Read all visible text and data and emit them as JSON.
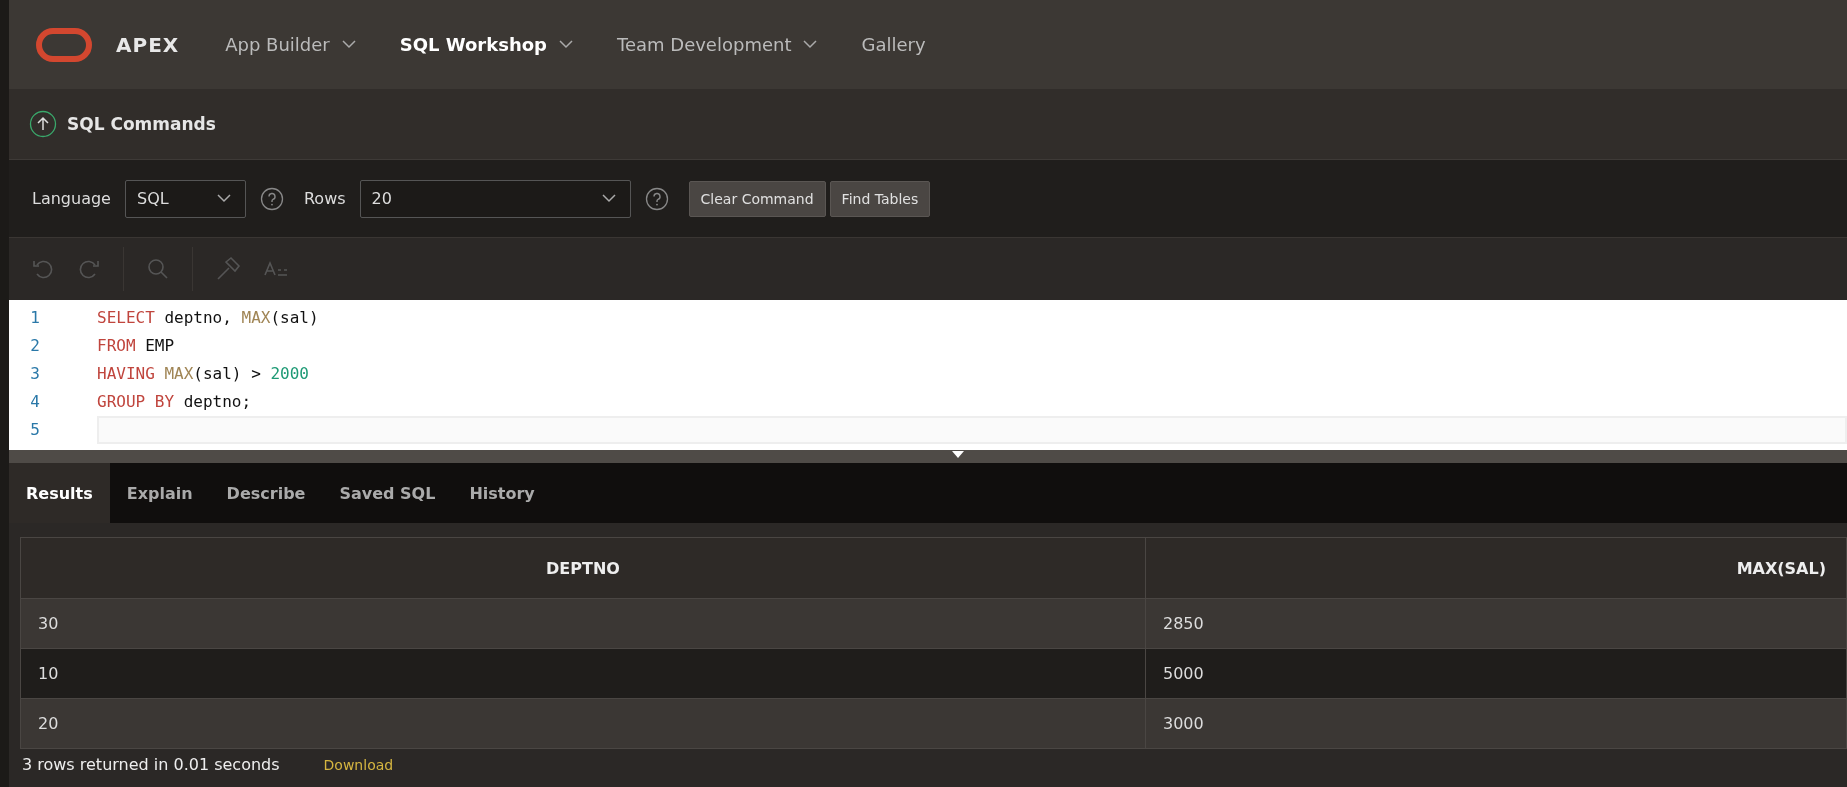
{
  "header": {
    "brand": "APEX",
    "nav": [
      {
        "label": "App Builder",
        "selected": false,
        "has_menu": true
      },
      {
        "label": "SQL Workshop",
        "selected": true,
        "has_menu": true
      },
      {
        "label": "Team Development",
        "selected": false,
        "has_menu": true
      },
      {
        "label": "Gallery",
        "selected": false,
        "has_menu": false
      }
    ]
  },
  "page_title": "SQL Commands",
  "toolbar": {
    "language_label": "Language",
    "language": "SQL",
    "rows_label": "Rows",
    "rows": "20",
    "buttons": [
      "Clear Command",
      "Find Tables"
    ]
  },
  "editor": {
    "lines": [
      [
        {
          "text": "SELECT",
          "kind": "keyword"
        },
        {
          "text": " deptno, ",
          "kind": "identifier"
        },
        {
          "text": "MAX",
          "kind": "function"
        },
        {
          "text": "(sal)",
          "kind": "identifier"
        }
      ],
      [
        {
          "text": "FROM",
          "kind": "keyword"
        },
        {
          "text": " EMP",
          "kind": "identifier"
        }
      ],
      [
        {
          "text": "HAVING",
          "kind": "keyword"
        },
        {
          "text": " MAX",
          "kind": "function"
        },
        {
          "text": "(sal) > ",
          "kind": "identifier"
        },
        {
          "text": "2000",
          "kind": "number"
        }
      ],
      [
        {
          "text": "GROUP BY",
          "kind": "keyword"
        },
        {
          "text": " deptno;",
          "kind": "identifier"
        }
      ]
    ],
    "line_numbers": [
      "1",
      "2",
      "3",
      "4",
      "5"
    ]
  },
  "result_tabs": [
    {
      "label": "Results",
      "selected": true
    },
    {
      "label": "Explain",
      "selected": false
    },
    {
      "label": "Describe",
      "selected": false
    },
    {
      "label": "Saved SQL",
      "selected": false
    },
    {
      "label": "History",
      "selected": false
    }
  ],
  "table": {
    "columns": [
      "DEPTNO",
      "MAX(SAL)"
    ],
    "rows": [
      [
        "30",
        "2850"
      ],
      [
        "10",
        "5000"
      ],
      [
        "20",
        "3000"
      ]
    ]
  },
  "footer": {
    "summary": "3 rows returned in 0.01 seconds",
    "link": "Download"
  }
}
